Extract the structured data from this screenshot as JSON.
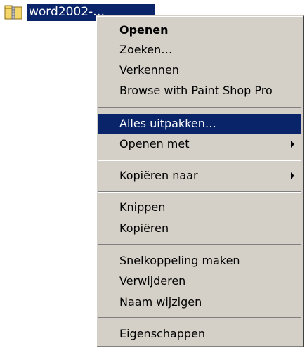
{
  "file": {
    "label": "word2002-…",
    "icon": "zip-folder-icon"
  },
  "menu": {
    "items": [
      {
        "label": "Openen",
        "bold": true
      },
      {
        "label": "Zoeken…"
      },
      {
        "label": "Verkennen"
      },
      {
        "label": "Browse with Paint Shop Pro"
      },
      {
        "label": "Alles uitpakken…",
        "highlighted": true
      },
      {
        "label": "Openen met",
        "submenu": true
      },
      {
        "label": "Kopiëren naar",
        "submenu": true
      },
      {
        "label": "Knippen"
      },
      {
        "label": "Kopiëren"
      },
      {
        "label": "Snelkoppeling maken"
      },
      {
        "label": "Verwijderen"
      },
      {
        "label": "Naam wijzigen"
      },
      {
        "label": "Eigenschappen"
      }
    ]
  },
  "colors": {
    "selection": "#0a246a",
    "menu_background": "#d4d0c8"
  }
}
